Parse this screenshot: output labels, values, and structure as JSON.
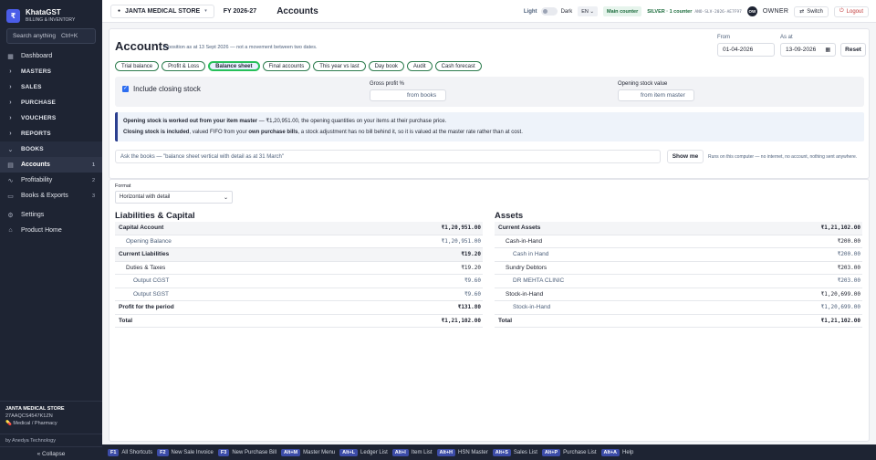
{
  "app": {
    "name": "KhataGST",
    "subtitle": "BILLING & INVENTORY",
    "logo_letter": "₹"
  },
  "search": {
    "label": "Search anything",
    "shortcut": "Ctrl+K"
  },
  "sidebar": {
    "items": [
      {
        "label": "Dashboard",
        "icon": "grid-icon"
      },
      {
        "label": "MASTERS",
        "icon": "chevron-right-icon"
      },
      {
        "label": "SALES",
        "icon": "chevron-right-icon"
      },
      {
        "label": "PURCHASE",
        "icon": "chevron-right-icon"
      },
      {
        "label": "VOUCHERS",
        "icon": "chevron-right-icon"
      },
      {
        "label": "REPORTS",
        "icon": "chevron-right-icon"
      },
      {
        "label": "BOOKS",
        "icon": "chevron-down-icon"
      },
      {
        "label": "Accounts",
        "icon": "book-icon",
        "count": "1"
      },
      {
        "label": "Profitability",
        "icon": "trend-icon",
        "count": "2"
      },
      {
        "label": "Books & Exports",
        "icon": "doc-icon",
        "count": "3"
      },
      {
        "label": "Settings",
        "icon": "gear-icon"
      },
      {
        "label": "Product Home",
        "icon": "home-icon"
      }
    ],
    "store": {
      "name": "JANTA MEDICAL STORE",
      "gstin": "27AAQCS4547K1ZN",
      "type": "Medical / Pharmacy"
    },
    "by": "by Anedya Technology",
    "collapse": "« Collapse"
  },
  "topbar": {
    "store": "JANTA MEDICAL STORE",
    "fy": "FY 2026-27",
    "page": "Accounts",
    "theme_light": "Light",
    "theme_dark": "Dark",
    "lang": "EN",
    "counter": "Main counter",
    "plan": "SILVER · 1 counter",
    "plan_code": "ANO-SLV-2026-AE7F97",
    "avatar": "OW",
    "owner": "OWNER",
    "switch": "Switch",
    "logout": "Logout"
  },
  "header": {
    "title": "Accounts",
    "subtitle": "A position as at 13 Sept 2026 — not a movement between two dates.",
    "from_label": "From",
    "from_value": "01-04-2026",
    "asat_label": "As at",
    "asat_value": "13-09-2026",
    "reset": "Reset",
    "tabs": [
      "Trial balance",
      "Profit & Loss",
      "Balance sheet",
      "Final accounts",
      "This year vs last",
      "Day book",
      "Audit",
      "Cash forecast"
    ],
    "include_closing": "Include closing stock",
    "gross_profit_label": "Gross profit %",
    "gross_profit_placeholder": "from books",
    "opening_stock_label": "Opening stock value",
    "opening_stock_placeholder": "from item master",
    "note_line1_b": "Opening stock is worked out from your item master",
    "note_line1": " — ₹1,20,951.00, the opening quantities on your items at their purchase price.",
    "note_line2_b": "Closing stock is included",
    "note_line2_m": ", valued FIFO from your ",
    "note_line2_b2": "own purchase bills",
    "note_line2": ", a stock adjustment has no bill behind it, so it is valued at the master rate rather than at cost.",
    "ask_placeholder": "Ask the books — \"balance sheet vertical with detail as at 31 March\"",
    "show_me": "Show me",
    "runs": "Runs on this computer — no internet, no account, nothing sent anywhere."
  },
  "report": {
    "format_label": "Format",
    "format_value": "Horizontal with detail",
    "liab_title": "Liabilities & Capital",
    "assets_title": "Assets",
    "liabilities": [
      {
        "label": "Capital Account",
        "amount": "₹1,20,951.00",
        "style": "b shade",
        "indent": 0
      },
      {
        "label": "Opening Balance",
        "amount": "₹1,20,951.00",
        "style": "grey",
        "indent": 1
      },
      {
        "label": "Current Liabilities",
        "amount": "₹19.20",
        "style": "b shade",
        "indent": 0
      },
      {
        "label": "Duties & Taxes",
        "amount": "₹19.20",
        "style": "",
        "indent": 1
      },
      {
        "label": "Output CGST",
        "amount": "₹9.60",
        "style": "grey",
        "indent": 2
      },
      {
        "label": "Output SGST",
        "amount": "₹9.60",
        "style": "grey",
        "indent": 2
      },
      {
        "label": "Profit for the period",
        "amount": "₹131.80",
        "style": "b",
        "indent": 0
      },
      {
        "label": "Total",
        "amount": "₹1,21,102.00",
        "style": "b",
        "indent": 0
      }
    ],
    "assets": [
      {
        "label": "Current Assets",
        "amount": "₹1,21,102.00",
        "style": "b shade",
        "indent": 0
      },
      {
        "label": "Cash-in-Hand",
        "amount": "₹200.00",
        "style": "",
        "indent": 1
      },
      {
        "label": "Cash in Hand",
        "amount": "₹200.00",
        "style": "grey",
        "indent": 2
      },
      {
        "label": "Sundry Debtors",
        "amount": "₹203.00",
        "style": "",
        "indent": 1
      },
      {
        "label": "DR MEHTA CLINIC",
        "amount": "₹203.00",
        "style": "grey",
        "indent": 2
      },
      {
        "label": "Stock-in-Hand",
        "amount": "₹1,20,699.00",
        "style": "",
        "indent": 1
      },
      {
        "label": "Stock-in-Hand",
        "amount": "₹1,20,699.00",
        "style": "grey",
        "indent": 2
      },
      {
        "label": "Total",
        "amount": "₹1,21,102.00",
        "style": "b",
        "indent": 0
      }
    ]
  },
  "footer": [
    {
      "key": "F1",
      "label": "All Shortcuts"
    },
    {
      "key": "F2",
      "label": "New Sale Invoice"
    },
    {
      "key": "F3",
      "label": "New Purchase Bill"
    },
    {
      "key": "Alt+M",
      "label": "Master Menu"
    },
    {
      "key": "Alt+L",
      "label": "Ledger List"
    },
    {
      "key": "Alt+I",
      "label": "Item List"
    },
    {
      "key": "Alt+H",
      "label": "HSN Master"
    },
    {
      "key": "Alt+S",
      "label": "Sales List"
    },
    {
      "key": "Alt+P",
      "label": "Purchase List"
    },
    {
      "key": "Alt+A",
      "label": "Help"
    }
  ],
  "colors": {
    "sidebar": "#1e2433",
    "accent": "#27c05a",
    "tab_border": "#2e7d4f",
    "note_bar": "#2b3f8f"
  }
}
